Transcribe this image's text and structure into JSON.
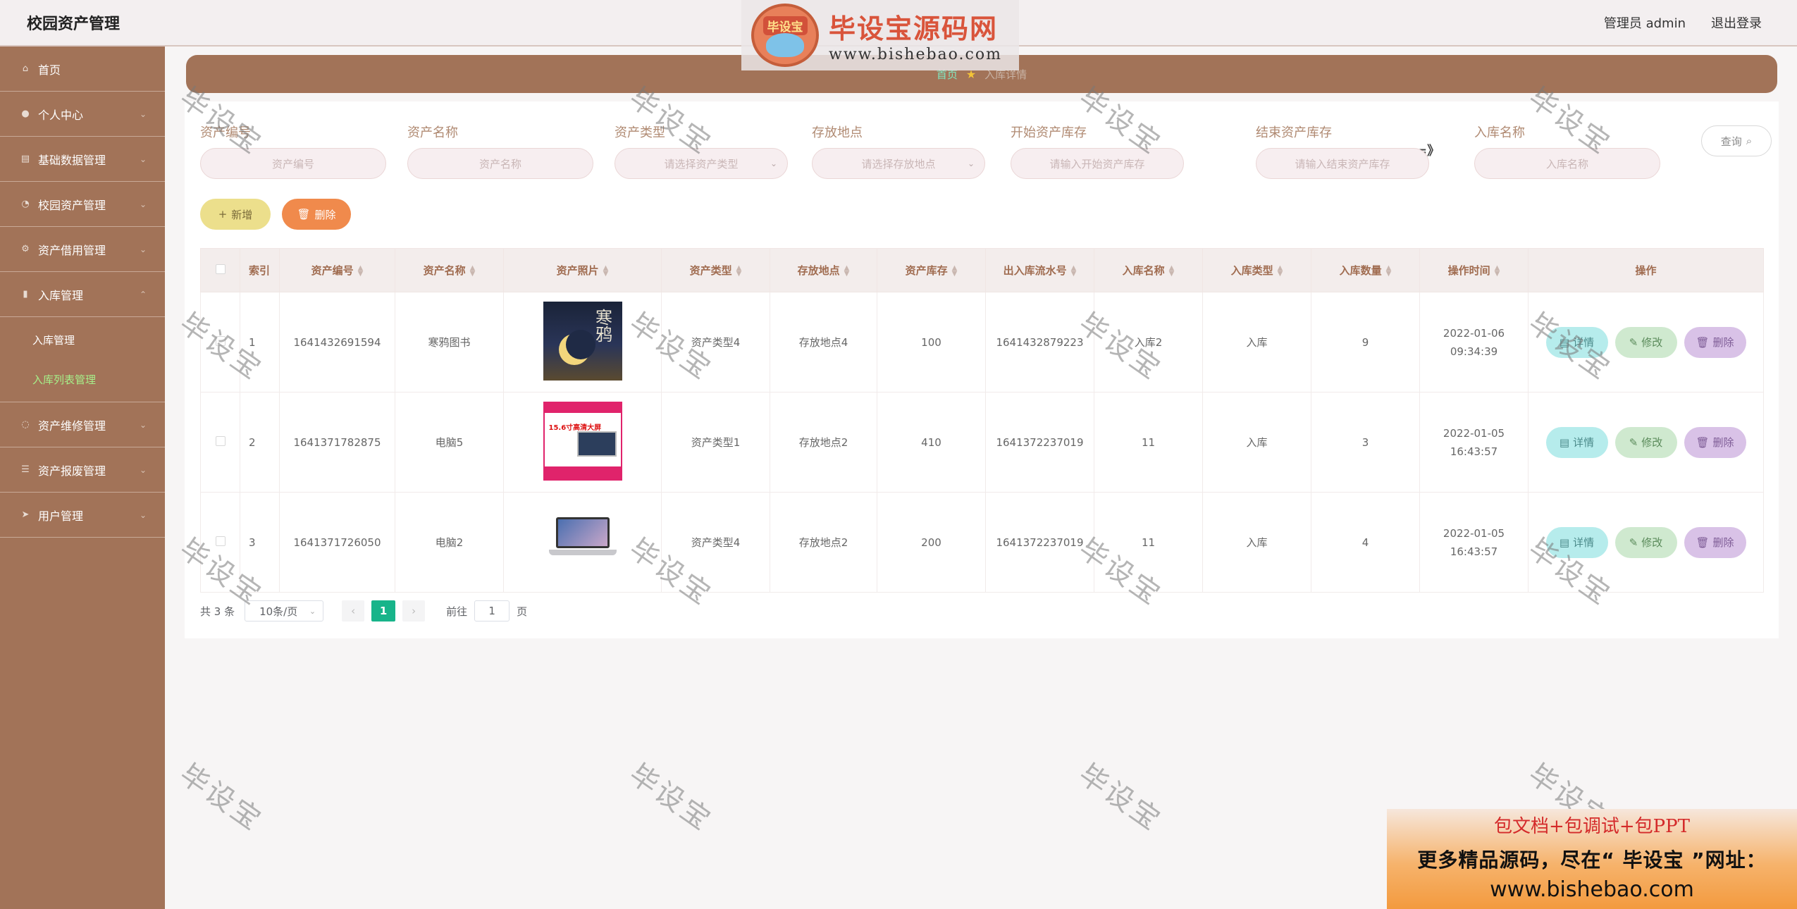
{
  "header": {
    "app_title": "校园资产管理",
    "user_label": "管理员 admin",
    "logout_label": "退出登录"
  },
  "watermark": {
    "badge": "毕设宝",
    "main": "毕设宝源码网",
    "url": "www.bishebao.com",
    "stamp": "毕设宝"
  },
  "sidebar": {
    "items": [
      {
        "label": "首页",
        "icon": "home-icon"
      },
      {
        "label": "个人中心",
        "icon": "user-icon"
      },
      {
        "label": "基础数据管理",
        "icon": "grid-icon"
      },
      {
        "label": "校园资产管理",
        "icon": "compass-icon"
      },
      {
        "label": "资产借用管理",
        "icon": "settings-icon"
      },
      {
        "label": "入库管理",
        "icon": "folder-icon"
      },
      {
        "label": "资产维修管理",
        "icon": "tool-icon"
      },
      {
        "label": "资产报废管理",
        "icon": "list-icon"
      },
      {
        "label": "用户管理",
        "icon": "send-icon"
      }
    ],
    "sub_items": [
      {
        "label": "入库管理"
      },
      {
        "label": "入库列表管理"
      }
    ]
  },
  "breadcrumb": {
    "home": "首页",
    "current": "入库详情"
  },
  "search": {
    "fields": [
      {
        "label": "资产编号",
        "placeholder": "资产编号"
      },
      {
        "label": "资产名称",
        "placeholder": "资产名称"
      },
      {
        "label": "资产类型",
        "placeholder": "请选择资产类型"
      },
      {
        "label": "存放地点",
        "placeholder": "请选择存放地点"
      },
      {
        "label": "开始资产库存",
        "placeholder": "请输入开始资产库存"
      },
      {
        "label": "结束资产库存",
        "placeholder": "请输入结束资产库存"
      },
      {
        "label": "入库名称",
        "placeholder": "入库名称"
      }
    ],
    "separator": "=》",
    "query_label": "查询"
  },
  "actions": {
    "add_label": "新增",
    "delete_label": "删除"
  },
  "table": {
    "columns": [
      "索引",
      "资产编号",
      "资产名称",
      "资产照片",
      "资产类型",
      "存放地点",
      "资产库存",
      "出入库流水号",
      "入库名称",
      "入库类型",
      "入库数量",
      "操作时间",
      "操作"
    ],
    "rows": [
      {
        "index": "1",
        "code": "1641432691594",
        "name": "寒鸦图书",
        "photo": "book-cover",
        "photo_title": "寒鸦",
        "type": "资产类型4",
        "place": "存放地点4",
        "stock": "100",
        "serial": "1641432879223",
        "in_name": "入库2",
        "in_type": "入库",
        "qty": "9",
        "time": "2022-01-06 09:34:39"
      },
      {
        "index": "2",
        "code": "1641371782875",
        "name": "电脑5",
        "photo": "laptop-ad",
        "photo_title": "15.6寸高清大屏",
        "type": "资产类型1",
        "place": "存放地点2",
        "stock": "410",
        "serial": "1641372237019",
        "in_name": "11",
        "in_type": "入库",
        "qty": "3",
        "time": "2022-01-05 16:43:57"
      },
      {
        "index": "3",
        "code": "1641371726050",
        "name": "电脑2",
        "photo": "laptop-photo",
        "photo_title": "",
        "type": "资产类型4",
        "place": "存放地点2",
        "stock": "200",
        "serial": "1641372237019",
        "in_name": "11",
        "in_type": "入库",
        "qty": "4",
        "time": "2022-01-05 16:43:57"
      }
    ],
    "op_detail": "详情",
    "op_edit": "修改",
    "op_remove": "删除"
  },
  "pagination": {
    "total": "共 3 条",
    "page_size": "10条/页",
    "current": "1",
    "goto_prefix": "前往",
    "goto_value": "1",
    "goto_suffix": "页"
  },
  "ad": {
    "line1": "包文档+包调试+包PPT",
    "line2": "更多精品源码，尽在“ 毕设宝 ”网址：",
    "line3": "www.bishebao.com"
  }
}
